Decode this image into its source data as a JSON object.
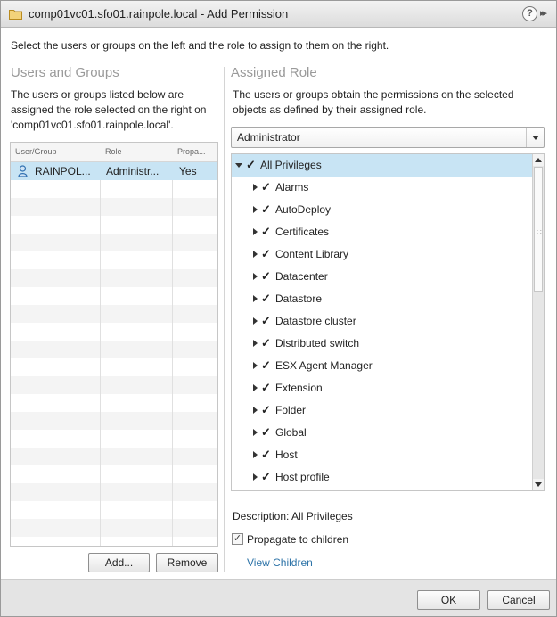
{
  "window": {
    "title": "comp01vc01.sfo01.rainpole.local - Add Permission",
    "help_glyph": "?",
    "expand_glyph": "▸▸"
  },
  "instructions": "Select the users or groups on the left and the role to assign to them on the right.",
  "users_groups": {
    "heading": "Users and Groups",
    "description": "The users or groups listed below are assigned the role selected on the right on 'comp01vc01.sfo01.rainpole.local'.",
    "columns": [
      "User/Group",
      "Role",
      "Propa..."
    ],
    "rows": [
      {
        "user": "RAINPOL...",
        "role": "Administr...",
        "propagate": "Yes"
      }
    ],
    "add_button": "Add...",
    "remove_button": "Remove"
  },
  "assigned_role": {
    "heading": "Assigned Role",
    "description": "The users or groups obtain the permissions on the selected objects as defined by their assigned role.",
    "selected_role": "Administrator",
    "tree_root": "All Privileges",
    "privileges": [
      "Alarms",
      "AutoDeploy",
      "Certificates",
      "Content Library",
      "Datacenter",
      "Datastore",
      "Datastore cluster",
      "Distributed switch",
      "ESX Agent Manager",
      "Extension",
      "Folder",
      "Global",
      "Host",
      "Host profile"
    ],
    "description_label": "Description:  All Privileges",
    "propagate_label": "Propagate to children",
    "propagate_checked": true,
    "view_children_link": "View Children"
  },
  "footer": {
    "ok_button": "OK",
    "cancel_button": "Cancel"
  },
  "colors": {
    "selection": "#c8e4f4",
    "link": "#2e74a8",
    "heading": "#9a9a9a"
  }
}
